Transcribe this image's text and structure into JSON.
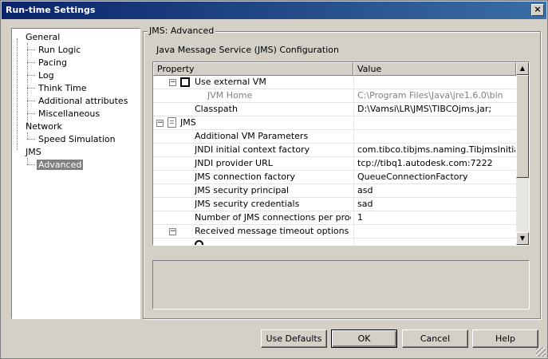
{
  "window": {
    "title": "Run-time Settings",
    "close_glyph": "×"
  },
  "tree": {
    "items": [
      {
        "label": "General"
      },
      {
        "label": "Run Logic"
      },
      {
        "label": "Pacing"
      },
      {
        "label": "Log"
      },
      {
        "label": "Think Time"
      },
      {
        "label": "Additional attributes"
      },
      {
        "label": "Miscellaneous"
      },
      {
        "label": "Network"
      },
      {
        "label": "Speed Simulation"
      },
      {
        "label": "JMS"
      },
      {
        "label": "Advanced",
        "selected": true
      }
    ]
  },
  "panel": {
    "title": "JMS: Advanced",
    "subtitle": "Java Message Service (JMS) Configuration"
  },
  "grid": {
    "headers": {
      "property": "Property",
      "value": "Value"
    },
    "rows": [
      {
        "property": "Use external VM",
        "value": ""
      },
      {
        "property": "JVM Home",
        "value": "C:\\Program Files\\Java\\jre1.6.0\\bin",
        "disabled": true
      },
      {
        "property": "Classpath",
        "value": "D:\\Vamsi\\LR\\JMS\\TIBCOjms.jar;"
      },
      {
        "property": "JMS",
        "value": ""
      },
      {
        "property": "Additional VM Parameters",
        "value": ""
      },
      {
        "property": "JNDI initial context factory",
        "value": "com.tibco.tibjms.naming.TibjmsInitia..."
      },
      {
        "property": "JNDI provider URL",
        "value": "tcp://tibq1.autodesk.com:7222"
      },
      {
        "property": "JMS connection factory",
        "value": "QueueConnectionFactory"
      },
      {
        "property": "JMS security principal",
        "value": "asd"
      },
      {
        "property": "JMS security credentials",
        "value": "sad"
      },
      {
        "property": "Number of JMS connections per process",
        "value": "1"
      },
      {
        "property": "Received message timeout options",
        "value": ""
      }
    ],
    "expander_minus": "−"
  },
  "buttons": {
    "use_defaults": "Use Defaults",
    "ok": "OK",
    "cancel": "Cancel",
    "help": "Help"
  },
  "scroll": {
    "up": "▲",
    "down": "▼"
  }
}
